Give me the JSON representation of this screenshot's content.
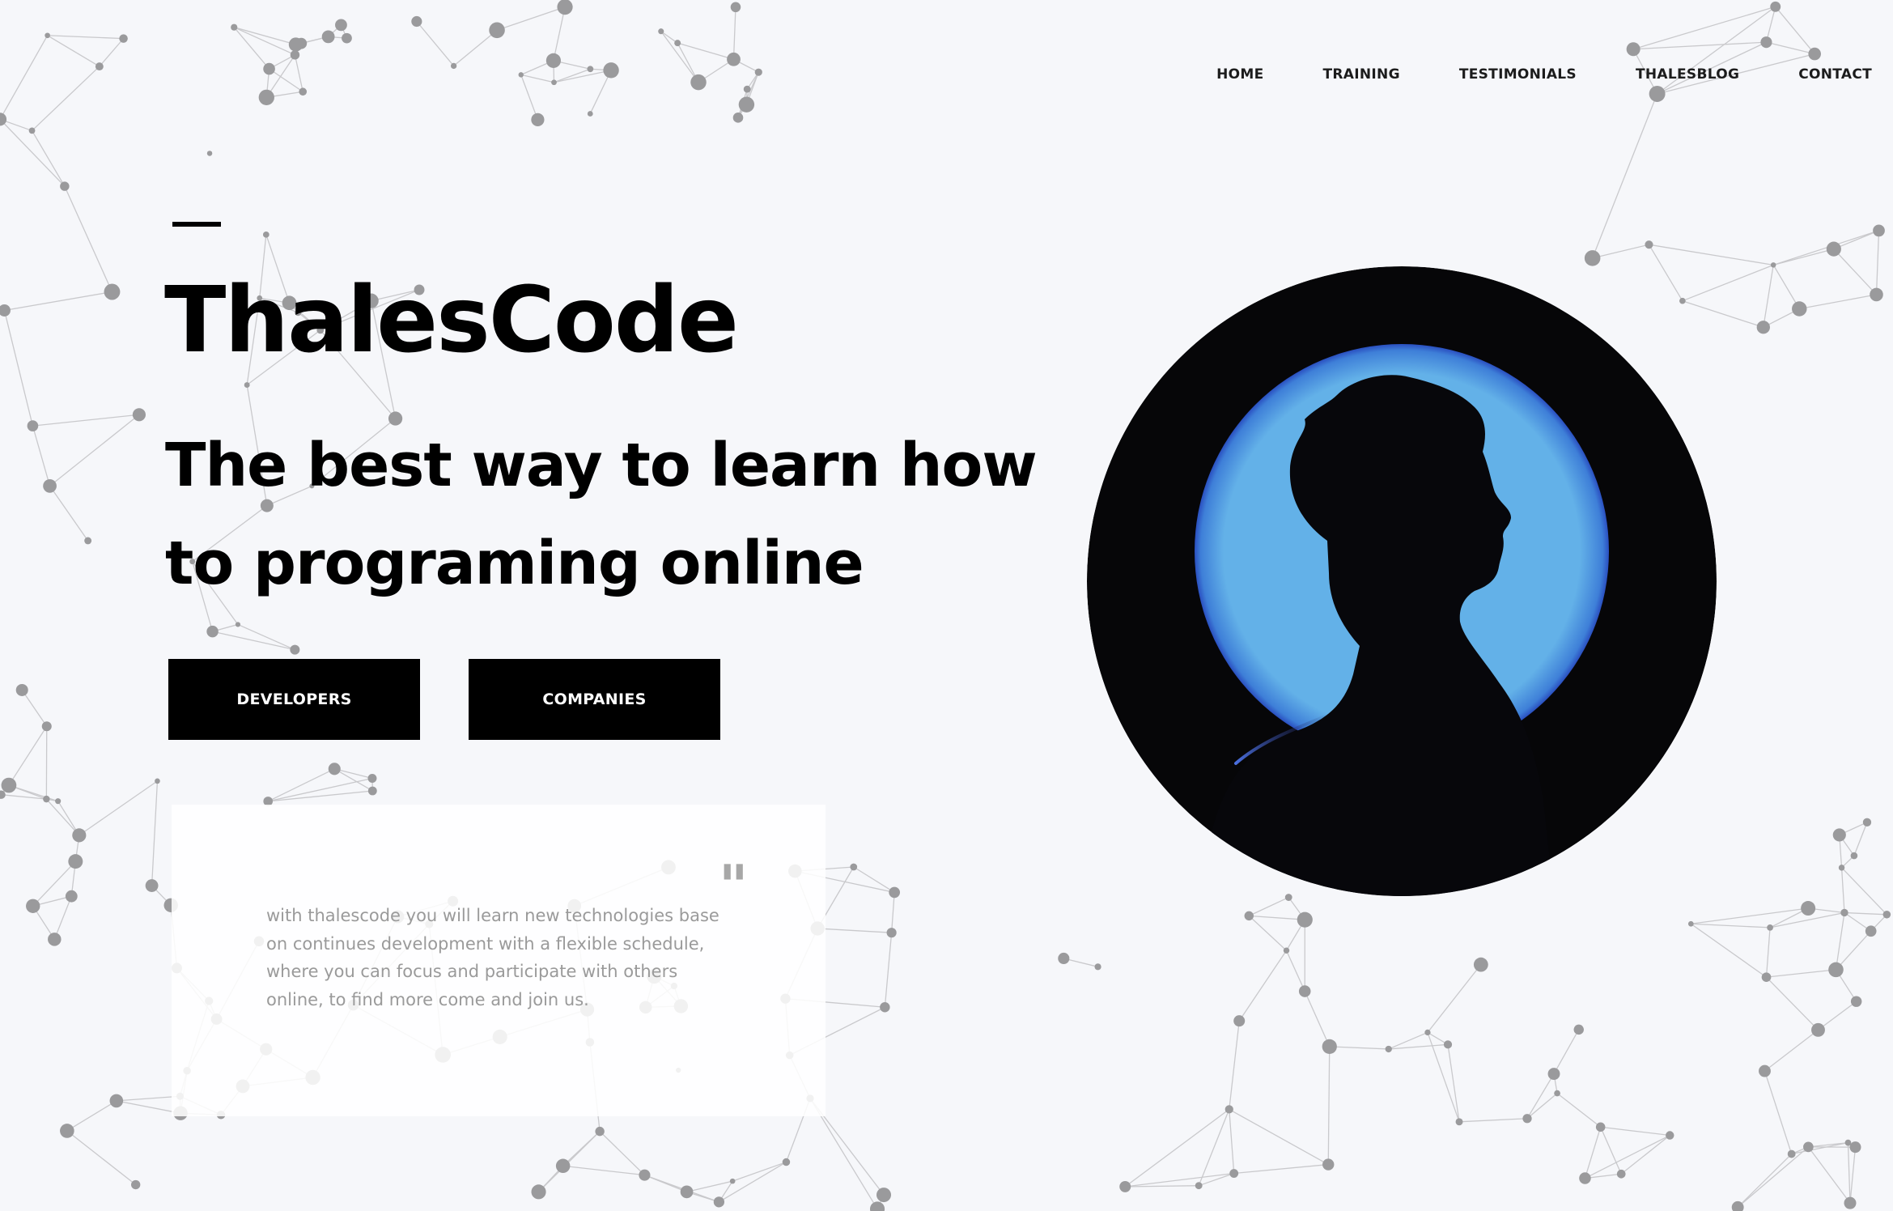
{
  "nav": {
    "items": [
      {
        "label": "HOME"
      },
      {
        "label": "TRAINING"
      },
      {
        "label": "TESTIMONIALS"
      },
      {
        "label": "THALESBLOG"
      },
      {
        "label": "CONTACT"
      }
    ]
  },
  "hero": {
    "brand": "ThalesCode",
    "tagline": "The best way to learn how to programing online",
    "buttons": {
      "developers": "DEVELOPERS",
      "companies": "COMPANIES"
    },
    "image": {
      "icon": "person-silhouette-icon",
      "circle_color": "#060608",
      "glow_color": "#63b1e8"
    }
  },
  "quote": {
    "mark": "\"",
    "text": "with thalescode you will learn new technologies base on continues development with a flexible schedule, where you can focus and participate with others online, to find more come and join us."
  },
  "colors": {
    "background": "#f6f7fa",
    "primary": "#000000",
    "muted_text": "#9a9a9a",
    "accent_blue": "#63b1e8"
  }
}
